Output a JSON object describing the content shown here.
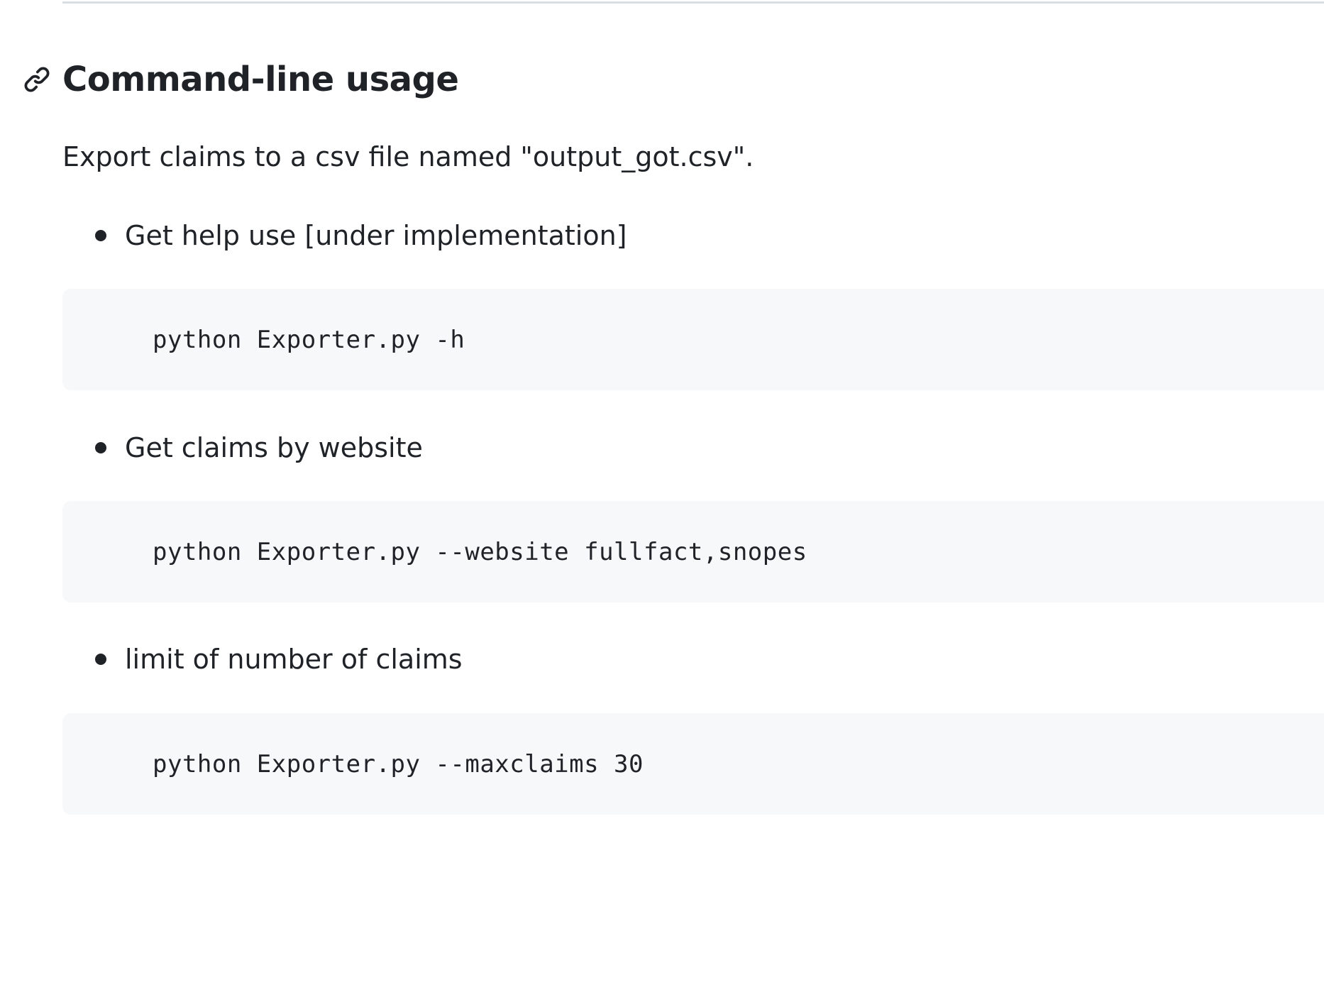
{
  "section": {
    "heading": "Command-line usage",
    "anchor_icon": "link-icon",
    "intro": "Export claims to a csv file named \"output_got.csv\"."
  },
  "items": [
    {
      "label": "Get help use [under implementation]",
      "code": "python Exporter.py -h"
    },
    {
      "label": "Get claims by website",
      "code": "python Exporter.py --website fullfact,snopes"
    },
    {
      "label": "limit of number of claims",
      "code": "python Exporter.py --maxclaims 30"
    }
  ],
  "colors": {
    "text": "#1f2328",
    "code_background": "#f6f8fa",
    "rule": "#d8dee4"
  }
}
